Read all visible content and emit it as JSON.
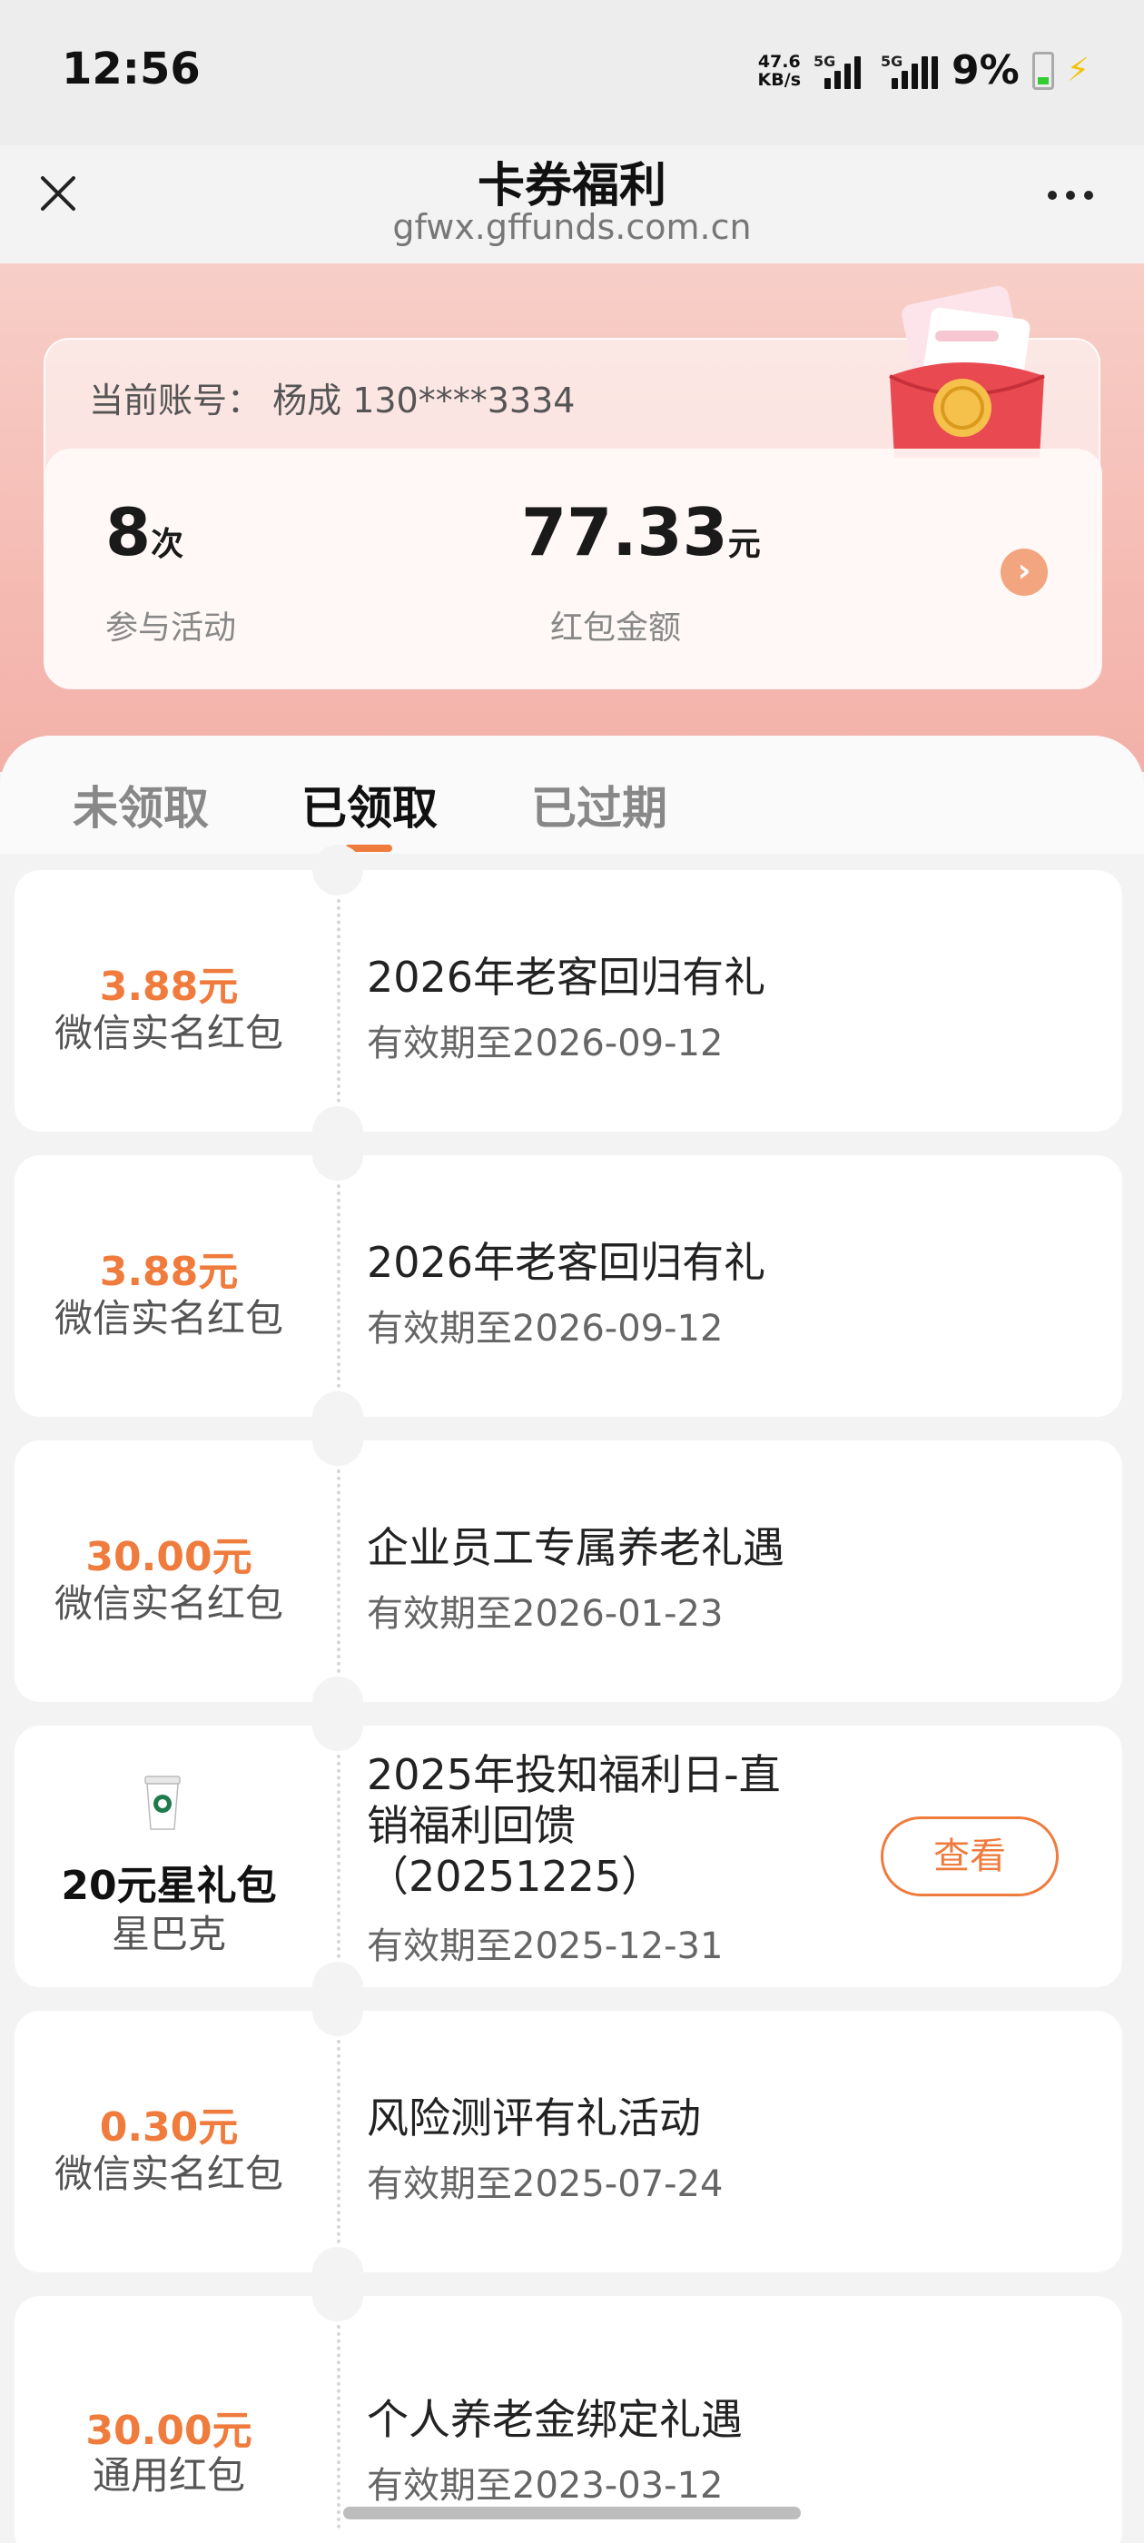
{
  "status_bar": {
    "time": "12:56",
    "net_speed_value": "47.6",
    "net_speed_unit": "KB/s",
    "sig1_label": "5G",
    "sig2_label": "5G",
    "battery_pct": "9%"
  },
  "nav": {
    "title": "卡券福利",
    "subtitle": "gfwx.gffunds.com.cn"
  },
  "account": {
    "label": "当前账号：",
    "value": "杨成 130****3334"
  },
  "stats": {
    "activities_value": "8",
    "activities_unit": "次",
    "activities_label": "参与活动",
    "amount_value": "77.33",
    "amount_unit": "元",
    "amount_label": "红包金额"
  },
  "tabs": [
    {
      "label": "未领取"
    },
    {
      "label": "已领取"
    },
    {
      "label": "已过期"
    }
  ],
  "active_tab": "已领取",
  "coupons": [
    {
      "amount": "3.88元",
      "type": "微信实名红包",
      "title": "2026年老客回归有礼",
      "expiry": "有效期至2026-09-12"
    },
    {
      "amount": "3.88元",
      "type": "微信实名红包",
      "title": "2026年老客回归有礼",
      "expiry": "有效期至2026-09-12"
    },
    {
      "amount": "30.00元",
      "type": "微信实名红包",
      "title": "企业员工专属养老礼遇",
      "expiry": "有效期至2026-01-23"
    },
    {
      "name": "20元星礼包",
      "brand": "星巴克",
      "title_line1": "2025年投知福利日-直",
      "title_line2": "销福利回馈",
      "title_line3": "（20251225）",
      "expiry": "有效期至2025-12-31",
      "button": "查看"
    },
    {
      "amount": "0.30元",
      "type": "微信实名红包",
      "title": "风险测评有礼活动",
      "expiry": "有效期至2025-07-24"
    },
    {
      "amount": "30.00元",
      "type": "通用红包",
      "title": "个人养老金绑定礼遇",
      "expiry": "有效期至2023-03-12"
    }
  ],
  "colors": {
    "accent": "#ef7b3c",
    "hero_bg": "#f5bcb4",
    "page_bg": "#f3f3f3"
  }
}
